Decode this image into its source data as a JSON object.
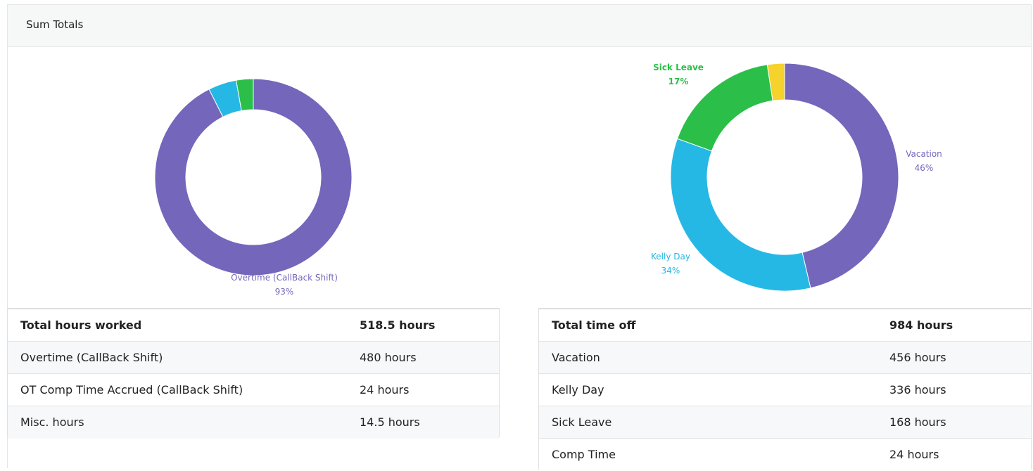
{
  "panel": {
    "title": "Sum Totals"
  },
  "colors": {
    "purple": "#7466bb",
    "blue": "#26b8e5",
    "green": "#2bbf4a",
    "yellow": "#f5d22c"
  },
  "worked_chart": {
    "label_name": "Overtime (CallBack Shift)",
    "label_pct": "93%"
  },
  "timeoff_chart": {
    "labels": [
      {
        "name": "Sick Leave",
        "pct": "17%"
      },
      {
        "name": "Vacation",
        "pct": "46%"
      },
      {
        "name": "Kelly Day",
        "pct": "34%"
      }
    ]
  },
  "chart_data": [
    {
      "type": "pie",
      "title": "",
      "categories": [
        "Overtime (CallBack Shift)",
        "OT Comp Time Accrued (CallBack Shift)",
        "Misc. hours"
      ],
      "values": [
        480,
        24,
        14.5
      ],
      "colors": [
        "#7466bb",
        "#26b8e5",
        "#2bbf4a"
      ],
      "donut": true
    },
    {
      "type": "pie",
      "title": "",
      "categories": [
        "Vacation",
        "Kelly Day",
        "Sick Leave",
        "Comp Time"
      ],
      "values": [
        456,
        336,
        168,
        24
      ],
      "colors": [
        "#7466bb",
        "#26b8e5",
        "#2bbf4a",
        "#f5d22c"
      ],
      "donut": true
    }
  ],
  "worked_table": {
    "header": {
      "label": "Total hours worked",
      "value": "518.5 hours"
    },
    "rows": [
      {
        "label": "Overtime (CallBack Shift)",
        "value": "480 hours"
      },
      {
        "label": "OT Comp Time Accrued (CallBack Shift)",
        "value": "24 hours"
      },
      {
        "label": "Misc. hours",
        "value": "14.5 hours"
      }
    ]
  },
  "timeoff_table": {
    "header": {
      "label": "Total time off",
      "value": "984 hours"
    },
    "rows": [
      {
        "label": "Vacation",
        "value": "456 hours"
      },
      {
        "label": "Kelly Day",
        "value": "336 hours"
      },
      {
        "label": "Sick Leave",
        "value": "168 hours"
      },
      {
        "label": "Comp Time",
        "value": "24 hours"
      }
    ]
  }
}
